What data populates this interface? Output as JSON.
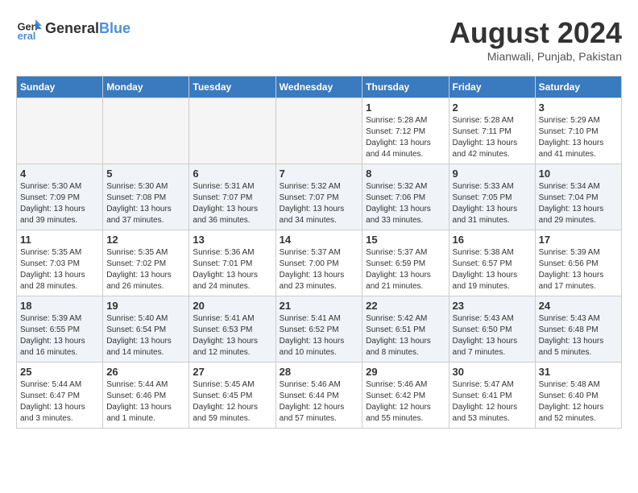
{
  "header": {
    "logo_line1": "General",
    "logo_line2": "Blue",
    "month_title": "August 2024",
    "location": "Mianwali, Punjab, Pakistan"
  },
  "days_of_week": [
    "Sunday",
    "Monday",
    "Tuesday",
    "Wednesday",
    "Thursday",
    "Friday",
    "Saturday"
  ],
  "weeks": [
    [
      {
        "day": "",
        "empty": true
      },
      {
        "day": "",
        "empty": true
      },
      {
        "day": "",
        "empty": true
      },
      {
        "day": "",
        "empty": true
      },
      {
        "day": "1",
        "sunrise": "5:28 AM",
        "sunset": "7:12 PM",
        "daylight": "13 hours and 44 minutes."
      },
      {
        "day": "2",
        "sunrise": "5:28 AM",
        "sunset": "7:11 PM",
        "daylight": "13 hours and 42 minutes."
      },
      {
        "day": "3",
        "sunrise": "5:29 AM",
        "sunset": "7:10 PM",
        "daylight": "13 hours and 41 minutes."
      }
    ],
    [
      {
        "day": "4",
        "sunrise": "5:30 AM",
        "sunset": "7:09 PM",
        "daylight": "13 hours and 39 minutes."
      },
      {
        "day": "5",
        "sunrise": "5:30 AM",
        "sunset": "7:08 PM",
        "daylight": "13 hours and 37 minutes."
      },
      {
        "day": "6",
        "sunrise": "5:31 AM",
        "sunset": "7:07 PM",
        "daylight": "13 hours and 36 minutes."
      },
      {
        "day": "7",
        "sunrise": "5:32 AM",
        "sunset": "7:07 PM",
        "daylight": "13 hours and 34 minutes."
      },
      {
        "day": "8",
        "sunrise": "5:32 AM",
        "sunset": "7:06 PM",
        "daylight": "13 hours and 33 minutes."
      },
      {
        "day": "9",
        "sunrise": "5:33 AM",
        "sunset": "7:05 PM",
        "daylight": "13 hours and 31 minutes."
      },
      {
        "day": "10",
        "sunrise": "5:34 AM",
        "sunset": "7:04 PM",
        "daylight": "13 hours and 29 minutes."
      }
    ],
    [
      {
        "day": "11",
        "sunrise": "5:35 AM",
        "sunset": "7:03 PM",
        "daylight": "13 hours and 28 minutes."
      },
      {
        "day": "12",
        "sunrise": "5:35 AM",
        "sunset": "7:02 PM",
        "daylight": "13 hours and 26 minutes."
      },
      {
        "day": "13",
        "sunrise": "5:36 AM",
        "sunset": "7:01 PM",
        "daylight": "13 hours and 24 minutes."
      },
      {
        "day": "14",
        "sunrise": "5:37 AM",
        "sunset": "7:00 PM",
        "daylight": "13 hours and 23 minutes."
      },
      {
        "day": "15",
        "sunrise": "5:37 AM",
        "sunset": "6:59 PM",
        "daylight": "13 hours and 21 minutes."
      },
      {
        "day": "16",
        "sunrise": "5:38 AM",
        "sunset": "6:57 PM",
        "daylight": "13 hours and 19 minutes."
      },
      {
        "day": "17",
        "sunrise": "5:39 AM",
        "sunset": "6:56 PM",
        "daylight": "13 hours and 17 minutes."
      }
    ],
    [
      {
        "day": "18",
        "sunrise": "5:39 AM",
        "sunset": "6:55 PM",
        "daylight": "13 hours and 16 minutes."
      },
      {
        "day": "19",
        "sunrise": "5:40 AM",
        "sunset": "6:54 PM",
        "daylight": "13 hours and 14 minutes."
      },
      {
        "day": "20",
        "sunrise": "5:41 AM",
        "sunset": "6:53 PM",
        "daylight": "13 hours and 12 minutes."
      },
      {
        "day": "21",
        "sunrise": "5:41 AM",
        "sunset": "6:52 PM",
        "daylight": "13 hours and 10 minutes."
      },
      {
        "day": "22",
        "sunrise": "5:42 AM",
        "sunset": "6:51 PM",
        "daylight": "13 hours and 8 minutes."
      },
      {
        "day": "23",
        "sunrise": "5:43 AM",
        "sunset": "6:50 PM",
        "daylight": "13 hours and 7 minutes."
      },
      {
        "day": "24",
        "sunrise": "5:43 AM",
        "sunset": "6:48 PM",
        "daylight": "13 hours and 5 minutes."
      }
    ],
    [
      {
        "day": "25",
        "sunrise": "5:44 AM",
        "sunset": "6:47 PM",
        "daylight": "13 hours and 3 minutes."
      },
      {
        "day": "26",
        "sunrise": "5:44 AM",
        "sunset": "6:46 PM",
        "daylight": "13 hours and 1 minute."
      },
      {
        "day": "27",
        "sunrise": "5:45 AM",
        "sunset": "6:45 PM",
        "daylight": "12 hours and 59 minutes."
      },
      {
        "day": "28",
        "sunrise": "5:46 AM",
        "sunset": "6:44 PM",
        "daylight": "12 hours and 57 minutes."
      },
      {
        "day": "29",
        "sunrise": "5:46 AM",
        "sunset": "6:42 PM",
        "daylight": "12 hours and 55 minutes."
      },
      {
        "day": "30",
        "sunrise": "5:47 AM",
        "sunset": "6:41 PM",
        "daylight": "12 hours and 53 minutes."
      },
      {
        "day": "31",
        "sunrise": "5:48 AM",
        "sunset": "6:40 PM",
        "daylight": "12 hours and 52 minutes."
      }
    ]
  ],
  "labels": {
    "sunrise": "Sunrise:",
    "sunset": "Sunset:",
    "daylight": "Daylight:"
  }
}
